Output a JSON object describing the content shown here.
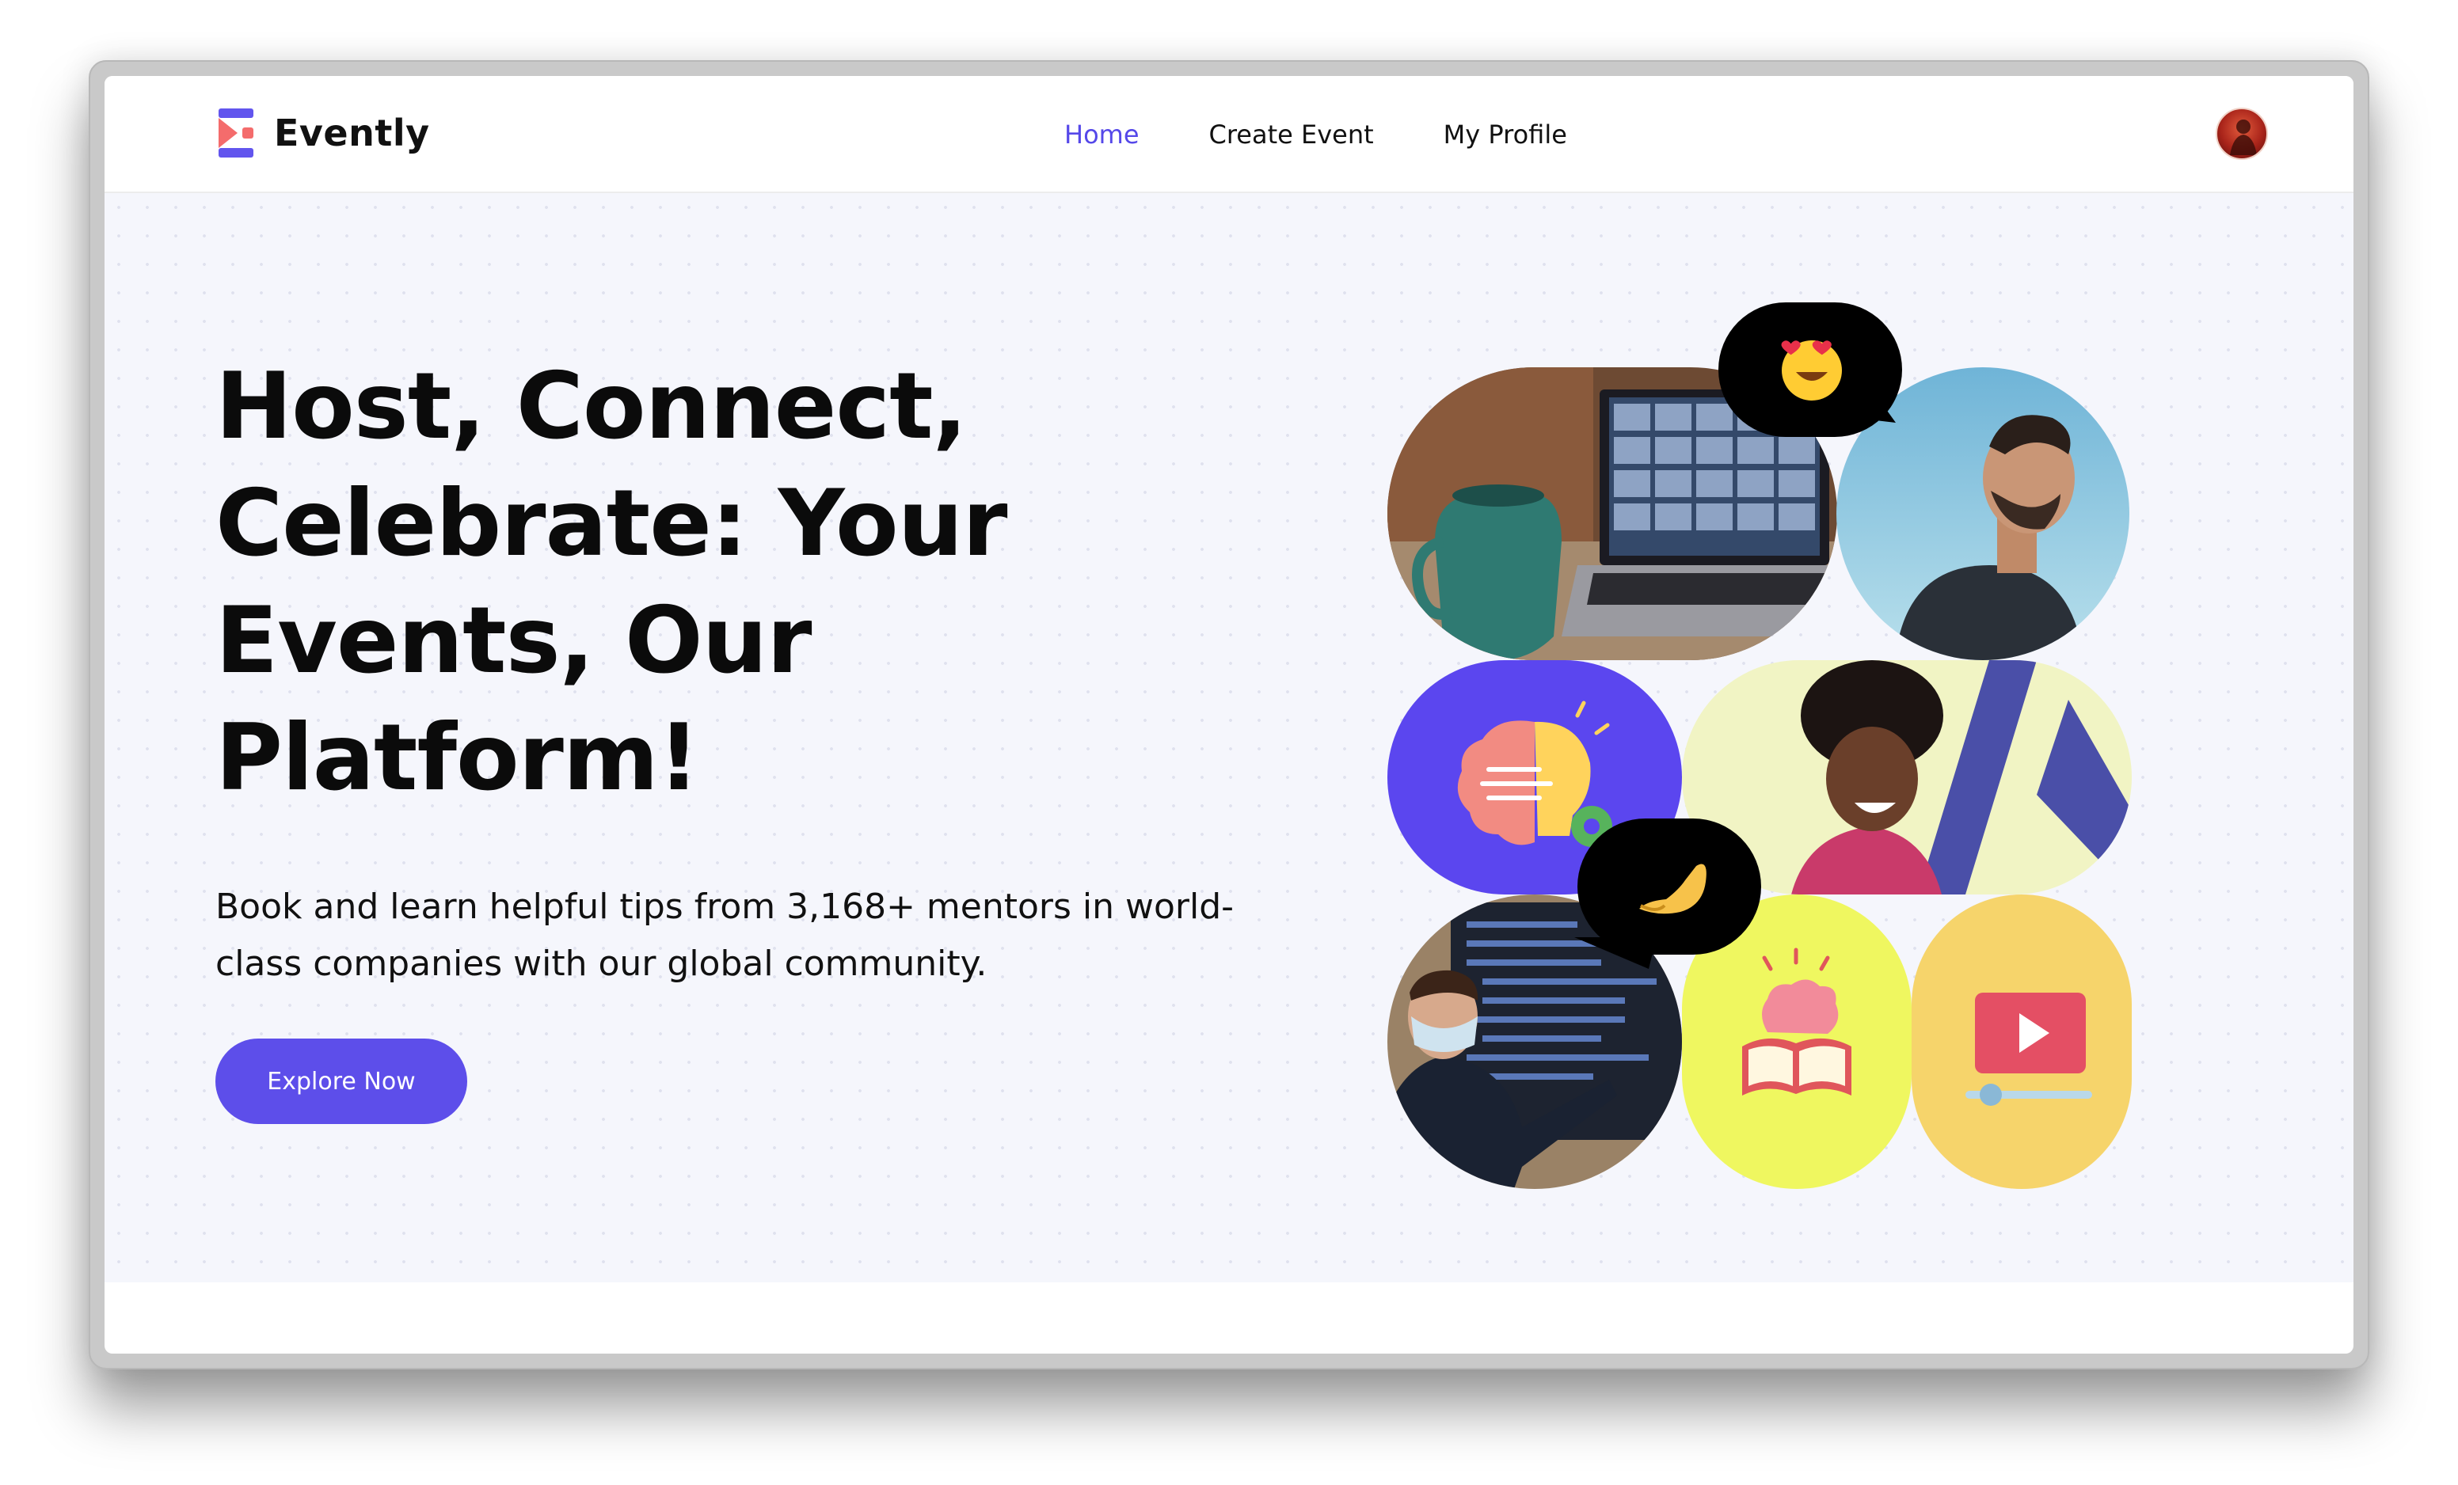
{
  "brand": {
    "name": "Evently"
  },
  "nav": {
    "items": [
      {
        "label": "Home",
        "active": true
      },
      {
        "label": "Create Event",
        "active": false
      },
      {
        "label": "My Profile",
        "active": false
      }
    ]
  },
  "hero": {
    "title": "Host, Connect, Celebrate: Your Events, Our Platform!",
    "subtitle": "Book and learn helpful tips from 3,168+ mentors in world-class companies with our global community.",
    "cta_label": "Explore Now"
  },
  "collage": {
    "tiles": [
      "video-call-laptop-photo",
      "laughing-man-photo",
      "brain-lightbulb-icon",
      "smiling-woman-photo",
      "presenter-with-mask-photo",
      "brain-book-icon",
      "video-play-icon"
    ],
    "bubbles": [
      "heart-eyes-emoji-icon",
      "pinched-fingers-emoji-icon"
    ]
  },
  "colors": {
    "accent": "#5d4eea",
    "nav_active": "#5548e9",
    "hero_bg": "#f5f6fc",
    "tile_purple": "#5b46ef",
    "tile_lime": "#eff760",
    "tile_amber": "#f6d46b"
  }
}
